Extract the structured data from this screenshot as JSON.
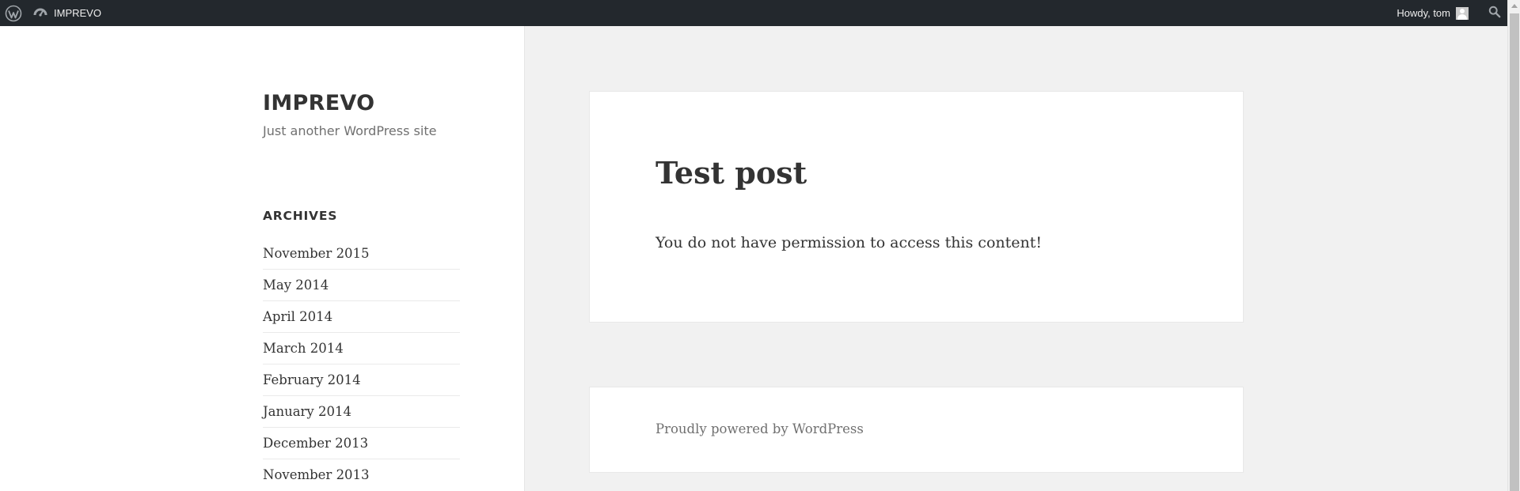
{
  "adminbar": {
    "site_name": "IMPREVO",
    "howdy": "Howdy, tom"
  },
  "site": {
    "title": "IMPREVO",
    "description": "Just another WordPress site"
  },
  "archives": {
    "title": "ARCHIVES",
    "items": [
      "November 2015",
      "May 2014",
      "April 2014",
      "March 2014",
      "February 2014",
      "January 2014",
      "December 2013",
      "November 2013"
    ]
  },
  "post": {
    "title": "Test post",
    "body": "You do not have permission to access this content!"
  },
  "footer": {
    "text": "Proudly powered by WordPress"
  },
  "colors": {
    "adminbar_bg": "#23282d",
    "page_bg": "#f1f1f1",
    "text": "#333333",
    "muted_text": "#707070"
  }
}
